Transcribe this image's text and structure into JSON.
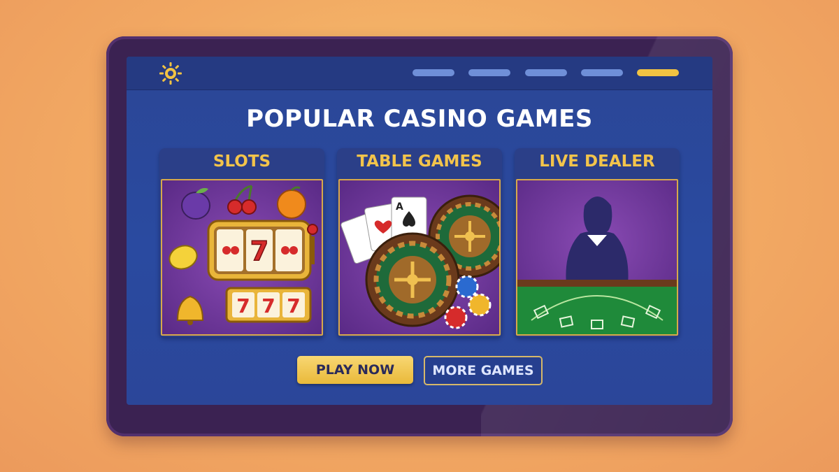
{
  "nav": {
    "logo_icon": "sun-chip-icon",
    "items": [
      {
        "label": "",
        "active": false
      },
      {
        "label": "",
        "active": false
      },
      {
        "label": "",
        "active": false
      },
      {
        "label": "",
        "active": false
      },
      {
        "label": "",
        "active": true
      }
    ]
  },
  "main": {
    "title": "POPULAR CASINO GAMES",
    "cards": [
      {
        "label": "SLOTS",
        "art_icon": "slot-machine-icon",
        "slot_digits": [
          "7",
          "7",
          "7"
        ],
        "reel_digit": "7"
      },
      {
        "label": "TABLE GAMES",
        "art_icon": "roulette-cards-icon",
        "card_rank": "A"
      },
      {
        "label": "LIVE DEALER",
        "art_icon": "live-dealer-icon"
      }
    ],
    "buttons": {
      "play_now": "PLAY NOW",
      "more_games": "MORE GAMES"
    }
  },
  "colors": {
    "accent_gold": "#f3c44b",
    "screen_blue": "#2a4aa0",
    "bezel_purple": "#3b2252",
    "background_orange": "#f2a963"
  }
}
